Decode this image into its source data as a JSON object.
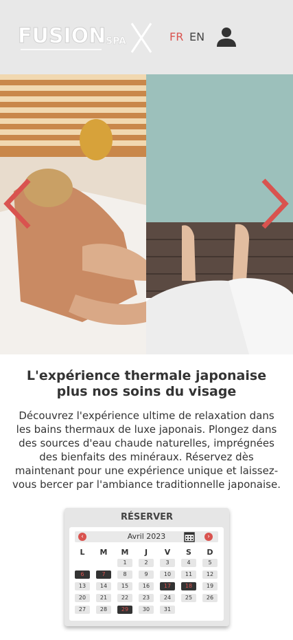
{
  "header": {
    "logo_text": "FUSION SPA",
    "lang_fr": "FR",
    "lang_en": "EN"
  },
  "hero": {
    "prev_icon": "chevron-left-icon",
    "next_icon": "chevron-right-icon"
  },
  "content": {
    "headline_line1": "L'expérience thermale japonaise",
    "headline_line2": "plus nos soins du visage",
    "body": "Découvrez l'expérience ultime de relaxation dans les bains thermaux de luxe japonais. Plongez dans des sources d'eau chaude naturelles, imprégnées des bienfaits des minéraux. Réservez dès maintenant pour une expérience unique et laissez-vous bercer par l'ambiance traditionnelle japonaise."
  },
  "booking": {
    "title": "RÉSERVER",
    "month": "Avril 2023",
    "days_of_week": [
      "L",
      "M",
      "M",
      "J",
      "V",
      "S",
      "D"
    ],
    "weeks": [
      [
        "",
        "",
        "1",
        "2",
        "3",
        "4",
        "5"
      ],
      [
        "6",
        "7",
        "8",
        "9",
        "10",
        "11",
        "12"
      ],
      [
        "13",
        "14",
        "15",
        "16",
        "17",
        "18",
        "19"
      ],
      [
        "20",
        "21",
        "22",
        "23",
        "24",
        "25",
        "26"
      ],
      [
        "27",
        "28",
        "29",
        "30",
        "31",
        "",
        ""
      ]
    ],
    "highlighted_days": [
      "6",
      "7",
      "17",
      "18",
      "29"
    ]
  },
  "colors": {
    "accent": "#d9534f",
    "header_bg": "#e8e8e8",
    "dark": "#333333"
  }
}
